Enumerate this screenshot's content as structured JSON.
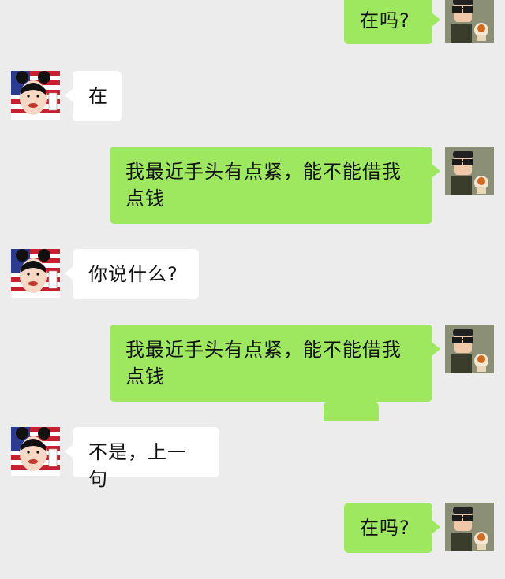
{
  "conversation": {
    "messages": [
      {
        "sender": "me",
        "text": "在吗?",
        "avatar": "cartoon-man-sunglasses-avatar"
      },
      {
        "sender": "other",
        "text": "在",
        "avatar": "girl-mouse-ears-flag-avatar"
      },
      {
        "sender": "me",
        "text": "我最近手头有点紧，能不能借我点钱",
        "avatar": "cartoon-man-sunglasses-avatar"
      },
      {
        "sender": "other",
        "text": "你说什么?",
        "avatar": "girl-mouse-ears-flag-avatar"
      },
      {
        "sender": "me",
        "text": "我最近手头有点紧，能不能借我点钱",
        "avatar": "cartoon-man-sunglasses-avatar"
      },
      {
        "sender": "other",
        "text": "不是，上一句",
        "avatar": "girl-mouse-ears-flag-avatar"
      },
      {
        "sender": "me",
        "text": "在吗?",
        "avatar": "cartoon-man-sunglasses-avatar"
      }
    ]
  },
  "colors": {
    "background": "#ececec",
    "my_bubble": "#9de85f",
    "their_bubble": "#ffffff"
  }
}
